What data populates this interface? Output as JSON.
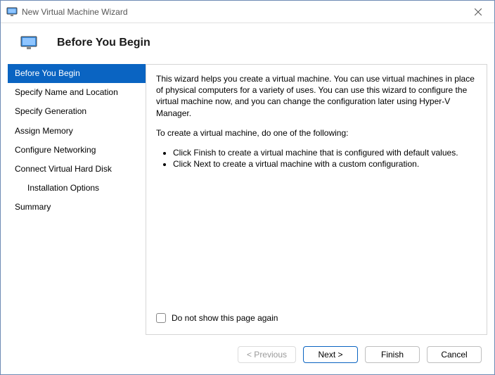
{
  "window": {
    "title": "New Virtual Machine Wizard"
  },
  "header": {
    "title": "Before You Begin"
  },
  "sidebar": {
    "items": [
      {
        "label": "Before You Begin",
        "selected": true,
        "indent": false
      },
      {
        "label": "Specify Name and Location",
        "selected": false,
        "indent": false
      },
      {
        "label": "Specify Generation",
        "selected": false,
        "indent": false
      },
      {
        "label": "Assign Memory",
        "selected": false,
        "indent": false
      },
      {
        "label": "Configure Networking",
        "selected": false,
        "indent": false
      },
      {
        "label": "Connect Virtual Hard Disk",
        "selected": false,
        "indent": false
      },
      {
        "label": "Installation Options",
        "selected": false,
        "indent": true
      },
      {
        "label": "Summary",
        "selected": false,
        "indent": false
      }
    ]
  },
  "content": {
    "para1": "This wizard helps you create a virtual machine. You can use virtual machines in place of physical computers for a variety of uses. You can use this wizard to configure the virtual machine now, and you can change the configuration later using Hyper-V Manager.",
    "para2": "To create a virtual machine, do one of the following:",
    "bullets": [
      "Click Finish to create a virtual machine that is configured with default values.",
      "Click Next to create a virtual machine with a custom configuration."
    ],
    "checkbox_label": "Do not show this page again"
  },
  "footer": {
    "previous": "< Previous",
    "next": "Next >",
    "finish": "Finish",
    "cancel": "Cancel"
  }
}
